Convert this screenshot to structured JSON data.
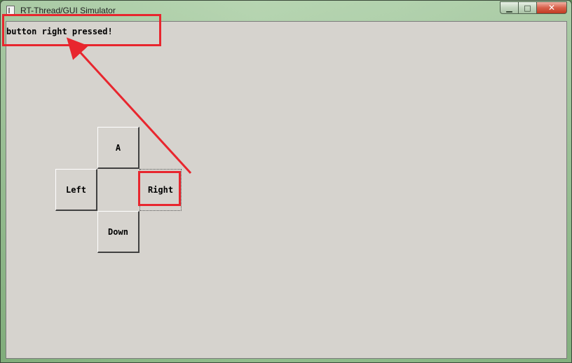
{
  "window": {
    "title": "RT-Thread/GUI Simulator",
    "controls": {
      "minimize_glyph": "▁",
      "maximize_glyph": "□",
      "close_glyph": "✕"
    }
  },
  "label": {
    "text": "button right pressed!"
  },
  "buttons": {
    "a": "A",
    "left": "Left",
    "right": "Right",
    "down": "Down"
  },
  "annotation": {
    "color": "#e8262e"
  },
  "icons": {
    "app": "app-window-icon",
    "minimize": "minimize-icon",
    "maximize": "maximize-icon",
    "close": "close-icon"
  }
}
